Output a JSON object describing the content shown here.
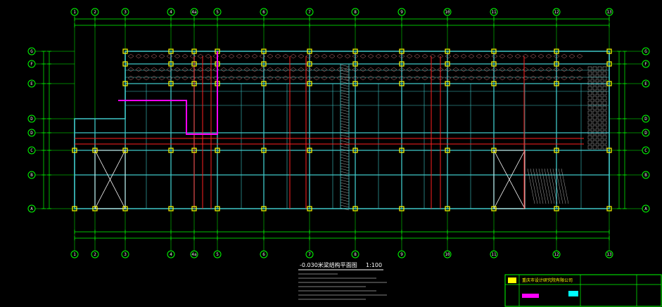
{
  "drawing": {
    "caption": "-0.030米梁结构平面图",
    "scale": "1:100",
    "title_block_company": "重庆市设计研究院有限公司",
    "grid_top": [
      "1",
      "2",
      "3",
      "4",
      "4a",
      "5",
      "6",
      "7",
      "8",
      "9",
      "10",
      "11",
      "12",
      "13"
    ],
    "grid_side": [
      "G",
      "F",
      "E",
      "D",
      "D",
      "C",
      "B",
      "A"
    ]
  },
  "colors": {
    "background": "#000000",
    "frame": "#00ff00",
    "beam": "#3fc8c8",
    "column": "#ffff00",
    "rebar": "#ff2020",
    "highlight": "#ff00ff",
    "hatch": "#d8d8d8"
  }
}
